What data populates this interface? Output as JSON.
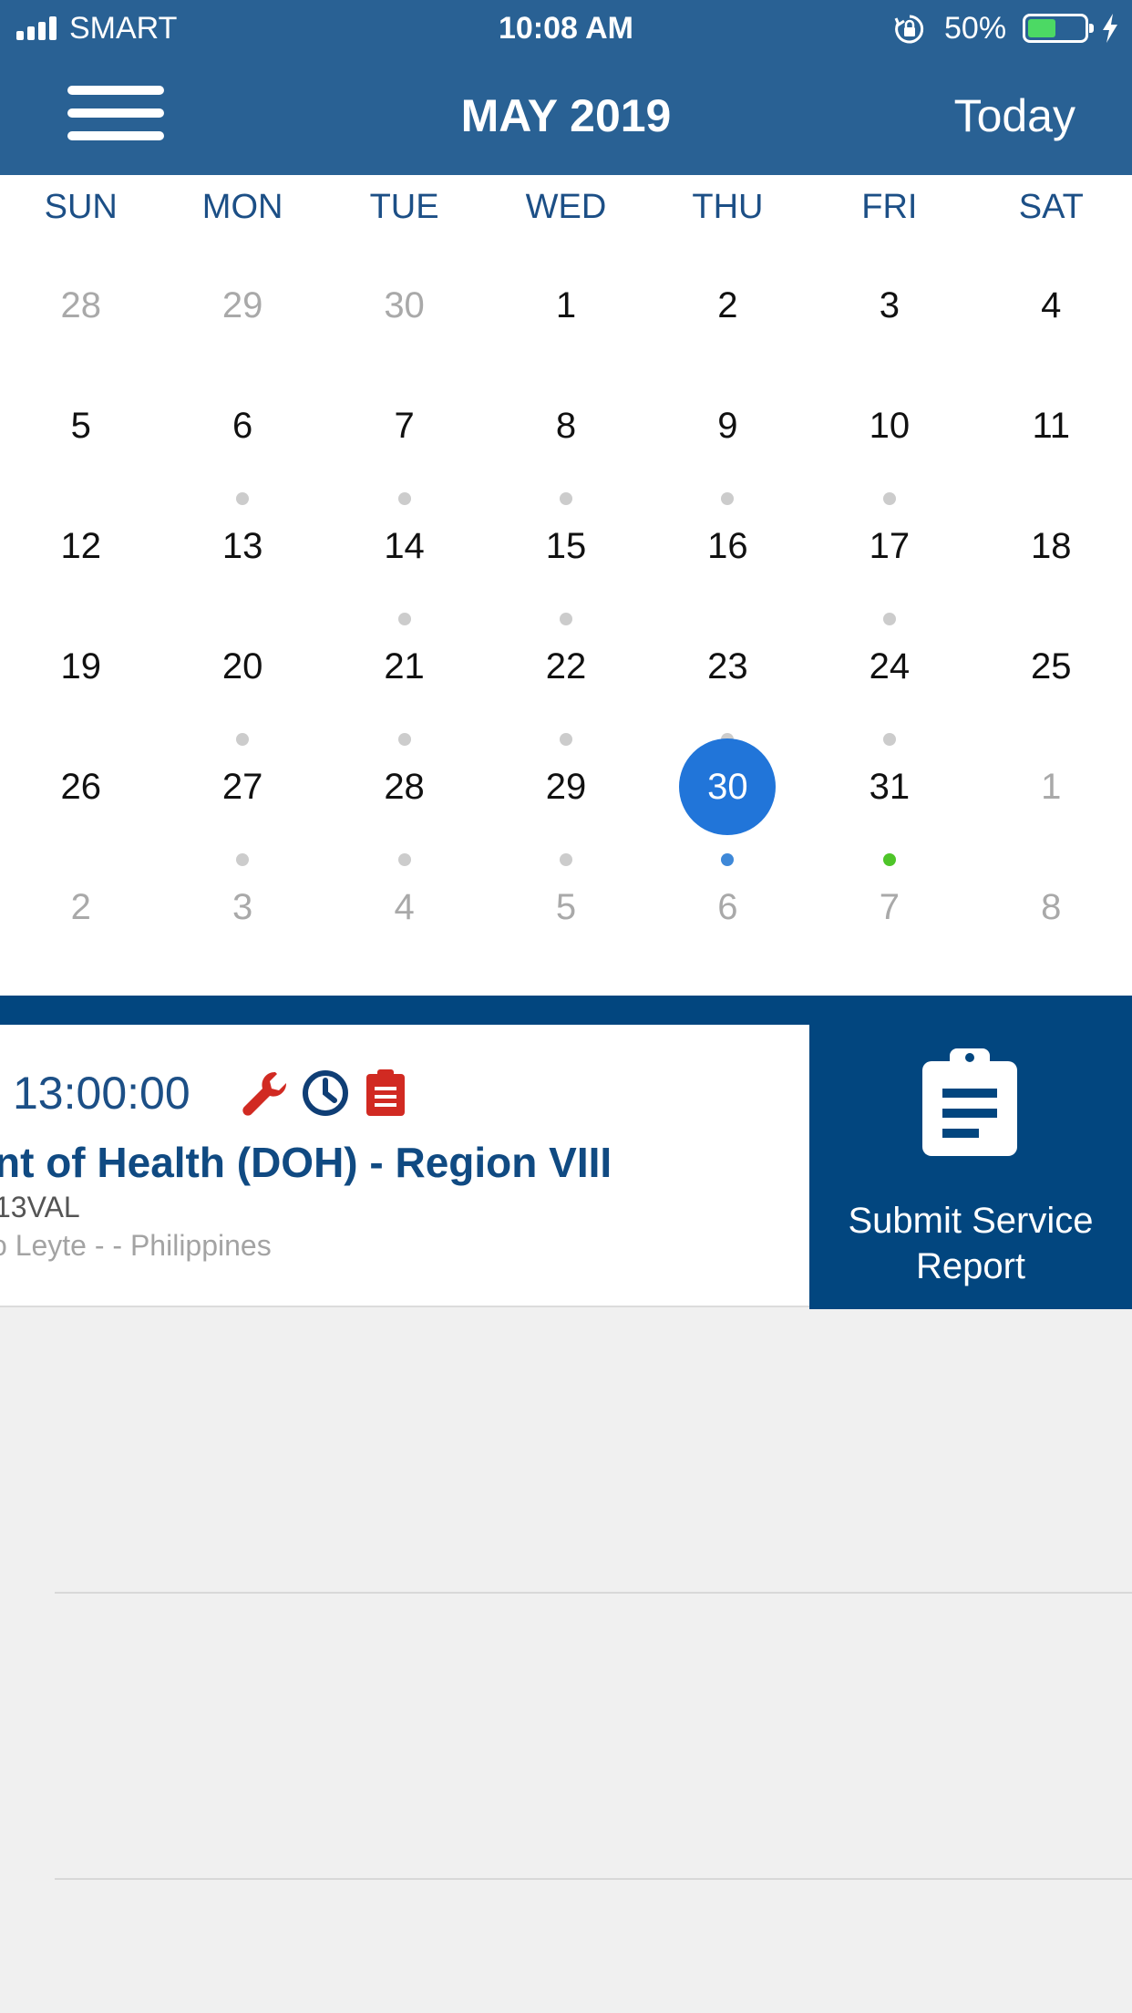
{
  "status": {
    "carrier": "SMART",
    "time": "10:08 AM",
    "battery_percent": "50%",
    "battery_level": 0.5
  },
  "header": {
    "title": "MAY 2019",
    "today_label": "Today"
  },
  "calendar": {
    "weekdays": [
      "SUN",
      "MON",
      "TUE",
      "WED",
      "THU",
      "FRI",
      "SAT"
    ],
    "days": [
      {
        "label": "28",
        "muted": true,
        "dot": "none"
      },
      {
        "label": "29",
        "muted": true,
        "dot": "none"
      },
      {
        "label": "30",
        "muted": true,
        "dot": "none"
      },
      {
        "label": "1",
        "muted": false,
        "dot": "none"
      },
      {
        "label": "2",
        "muted": false,
        "dot": "none"
      },
      {
        "label": "3",
        "muted": false,
        "dot": "none"
      },
      {
        "label": "4",
        "muted": false,
        "dot": "none"
      },
      {
        "label": "5",
        "muted": false,
        "dot": "none"
      },
      {
        "label": "6",
        "muted": false,
        "dot": "gray"
      },
      {
        "label": "7",
        "muted": false,
        "dot": "gray"
      },
      {
        "label": "8",
        "muted": false,
        "dot": "gray"
      },
      {
        "label": "9",
        "muted": false,
        "dot": "gray"
      },
      {
        "label": "10",
        "muted": false,
        "dot": "gray"
      },
      {
        "label": "11",
        "muted": false,
        "dot": "none"
      },
      {
        "label": "12",
        "muted": false,
        "dot": "none"
      },
      {
        "label": "13",
        "muted": false,
        "dot": "none"
      },
      {
        "label": "14",
        "muted": false,
        "dot": "gray"
      },
      {
        "label": "15",
        "muted": false,
        "dot": "gray"
      },
      {
        "label": "16",
        "muted": false,
        "dot": "none"
      },
      {
        "label": "17",
        "muted": false,
        "dot": "gray"
      },
      {
        "label": "18",
        "muted": false,
        "dot": "none"
      },
      {
        "label": "19",
        "muted": false,
        "dot": "none"
      },
      {
        "label": "20",
        "muted": false,
        "dot": "gray"
      },
      {
        "label": "21",
        "muted": false,
        "dot": "gray"
      },
      {
        "label": "22",
        "muted": false,
        "dot": "gray"
      },
      {
        "label": "23",
        "muted": false,
        "dot": "gray"
      },
      {
        "label": "24",
        "muted": false,
        "dot": "gray"
      },
      {
        "label": "25",
        "muted": false,
        "dot": "none"
      },
      {
        "label": "26",
        "muted": false,
        "dot": "none"
      },
      {
        "label": "27",
        "muted": false,
        "dot": "gray"
      },
      {
        "label": "28",
        "muted": false,
        "dot": "gray"
      },
      {
        "label": "29",
        "muted": false,
        "dot": "gray"
      },
      {
        "label": "30",
        "muted": false,
        "dot": "blue",
        "selected": true
      },
      {
        "label": "31",
        "muted": false,
        "dot": "green"
      },
      {
        "label": "1",
        "muted": true,
        "dot": "none"
      },
      {
        "label": "2",
        "muted": true,
        "dot": "none"
      },
      {
        "label": "3",
        "muted": true,
        "dot": "none"
      },
      {
        "label": "4",
        "muted": true,
        "dot": "none"
      },
      {
        "label": "5",
        "muted": true,
        "dot": "none"
      },
      {
        "label": "6",
        "muted": true,
        "dot": "none"
      },
      {
        "label": "7",
        "muted": true,
        "dot": "none"
      },
      {
        "label": "8",
        "muted": true,
        "dot": "none"
      }
    ]
  },
  "event": {
    "time": "13:00:00",
    "organization": "nt of Health (DOH) - Region VIII",
    "code": "13VAL",
    "location": "o Leyte - - Philippines",
    "icons": [
      "wrench-icon",
      "clock-icon",
      "clipboard-icon"
    ]
  },
  "report_button": {
    "label": "Submit Service Report",
    "icon": "clipboard-icon"
  },
  "colors": {
    "header_bg": "#296194",
    "accent_dark": "#02467f",
    "selected_day": "#2175d9",
    "event_dot_green": "#4ec529",
    "icon_red": "#d12a22"
  }
}
